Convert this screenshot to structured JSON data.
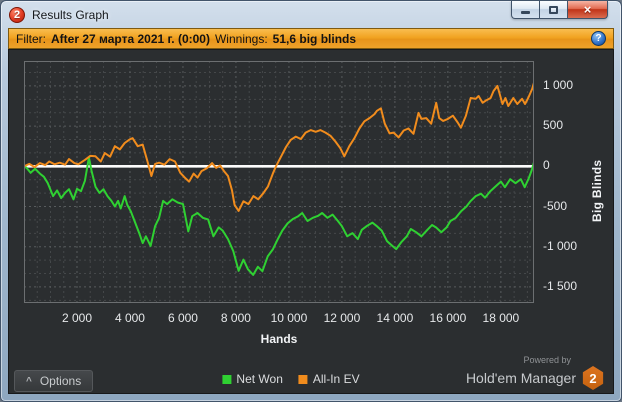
{
  "window": {
    "title": "Results Graph",
    "logo_glyph": "2",
    "controls": {
      "close_glyph": "×"
    }
  },
  "filter_bar": {
    "filter_label": "Filter:",
    "filter_value": "After 27 марта 2021 г. (0:00)",
    "winnings_label": "Winnings:",
    "winnings_value": "51,6 big blinds",
    "info_glyph": "?"
  },
  "chart_data": {
    "type": "line",
    "xlabel": "Hands",
    "ylabel": "Big Blinds",
    "xlim": [
      0,
      19250
    ],
    "ylim": [
      -1700,
      1310
    ],
    "grid": {
      "on": true,
      "x_minor": 500,
      "x_major": 2000,
      "y_major": 500,
      "y_minor_divisions": 3
    },
    "zero_line": true,
    "legend_position": "bottom",
    "background": "#2b2e30",
    "x_ticks": [
      {
        "value": 2000,
        "label": "2 000"
      },
      {
        "value": 4000,
        "label": "4 000"
      },
      {
        "value": 6000,
        "label": "6 000"
      },
      {
        "value": 8000,
        "label": "8 000"
      },
      {
        "value": 10000,
        "label": "10 000"
      },
      {
        "value": 12000,
        "label": "12 000"
      },
      {
        "value": 14000,
        "label": "14 000"
      },
      {
        "value": 16000,
        "label": "16 000"
      },
      {
        "value": 18000,
        "label": "18 000"
      }
    ],
    "y_ticks": [
      {
        "value": 1000,
        "label": "1 000"
      },
      {
        "value": 500,
        "label": "500"
      },
      {
        "value": 0,
        "label": "0"
      },
      {
        "value": -500,
        "label": "-500"
      },
      {
        "value": -1000,
        "label": "-1 000"
      },
      {
        "value": -1500,
        "label": "-1 500"
      }
    ],
    "series": [
      {
        "name": "Net Won",
        "color": "#2fd132",
        "points": [
          [
            0,
            0
          ],
          [
            100,
            -20
          ],
          [
            250,
            -80
          ],
          [
            420,
            -30
          ],
          [
            600,
            -90
          ],
          [
            750,
            -130
          ],
          [
            900,
            -210
          ],
          [
            1100,
            -370
          ],
          [
            1250,
            -300
          ],
          [
            1400,
            -395
          ],
          [
            1550,
            -330
          ],
          [
            1700,
            -285
          ],
          [
            1870,
            -410
          ],
          [
            2000,
            -280
          ],
          [
            2150,
            -310
          ],
          [
            2300,
            -180
          ],
          [
            2450,
            110
          ],
          [
            2550,
            -60
          ],
          [
            2700,
            -255
          ],
          [
            2850,
            -330
          ],
          [
            3000,
            -285
          ],
          [
            3150,
            -370
          ],
          [
            3300,
            -430
          ],
          [
            3430,
            -500
          ],
          [
            3550,
            -430
          ],
          [
            3650,
            -525
          ],
          [
            3800,
            -370
          ],
          [
            3900,
            -480
          ],
          [
            4030,
            -560
          ],
          [
            4200,
            -705
          ],
          [
            4350,
            -830
          ],
          [
            4480,
            -955
          ],
          [
            4600,
            -870
          ],
          [
            4780,
            -990
          ],
          [
            4950,
            -745
          ],
          [
            5100,
            -640
          ],
          [
            5250,
            -430
          ],
          [
            5400,
            -470
          ],
          [
            5600,
            -410
          ],
          [
            5800,
            -450
          ],
          [
            6000,
            -470
          ],
          [
            6200,
            -810
          ],
          [
            6350,
            -620
          ],
          [
            6550,
            -580
          ],
          [
            6750,
            -640
          ],
          [
            6950,
            -660
          ],
          [
            7150,
            -870
          ],
          [
            7350,
            -760
          ],
          [
            7500,
            -800
          ],
          [
            7700,
            -905
          ],
          [
            7900,
            -1055
          ],
          [
            8100,
            -1300
          ],
          [
            8280,
            -1160
          ],
          [
            8450,
            -1280
          ],
          [
            8650,
            -1350
          ],
          [
            8830,
            -1250
          ],
          [
            9000,
            -1305
          ],
          [
            9200,
            -1120
          ],
          [
            9400,
            -1030
          ],
          [
            9580,
            -905
          ],
          [
            9750,
            -800
          ],
          [
            9950,
            -710
          ],
          [
            10150,
            -655
          ],
          [
            10350,
            -620
          ],
          [
            10500,
            -580
          ],
          [
            10700,
            -680
          ],
          [
            10900,
            -640
          ],
          [
            11100,
            -615
          ],
          [
            11250,
            -580
          ],
          [
            11450,
            -640
          ],
          [
            11650,
            -600
          ],
          [
            11850,
            -680
          ],
          [
            12000,
            -745
          ],
          [
            12200,
            -870
          ],
          [
            12400,
            -830
          ],
          [
            12600,
            -905
          ],
          [
            12750,
            -790
          ],
          [
            12950,
            -740
          ],
          [
            13150,
            -700
          ],
          [
            13300,
            -740
          ],
          [
            13500,
            -800
          ],
          [
            13700,
            -930
          ],
          [
            13900,
            -990
          ],
          [
            14050,
            -1030
          ],
          [
            14250,
            -940
          ],
          [
            14450,
            -870
          ],
          [
            14600,
            -780
          ],
          [
            14800,
            -820
          ],
          [
            15000,
            -870
          ],
          [
            15200,
            -800
          ],
          [
            15400,
            -730
          ],
          [
            15550,
            -760
          ],
          [
            15750,
            -820
          ],
          [
            15950,
            -760
          ],
          [
            16100,
            -680
          ],
          [
            16300,
            -640
          ],
          [
            16500,
            -560
          ],
          [
            16700,
            -500
          ],
          [
            16850,
            -435
          ],
          [
            17050,
            -370
          ],
          [
            17250,
            -340
          ],
          [
            17400,
            -390
          ],
          [
            17600,
            -310
          ],
          [
            17800,
            -250
          ],
          [
            18000,
            -190
          ],
          [
            18150,
            -260
          ],
          [
            18350,
            -160
          ],
          [
            18550,
            -210
          ],
          [
            18750,
            -160
          ],
          [
            18900,
            -260
          ],
          [
            19050,
            -150
          ],
          [
            19150,
            -60
          ],
          [
            19250,
            52
          ]
        ]
      },
      {
        "name": "All-In EV",
        "color": "#f18c1d",
        "points": [
          [
            0,
            0
          ],
          [
            200,
            30
          ],
          [
            400,
            -10
          ],
          [
            600,
            40
          ],
          [
            800,
            15
          ],
          [
            950,
            60
          ],
          [
            1150,
            25
          ],
          [
            1350,
            45
          ],
          [
            1550,
            20
          ],
          [
            1700,
            90
          ],
          [
            1900,
            40
          ],
          [
            2050,
            25
          ],
          [
            2300,
            80
          ],
          [
            2500,
            130
          ],
          [
            2700,
            125
          ],
          [
            2900,
            60
          ],
          [
            3050,
            165
          ],
          [
            3250,
            120
          ],
          [
            3430,
            250
          ],
          [
            3620,
            210
          ],
          [
            3800,
            290
          ],
          [
            3990,
            335
          ],
          [
            4100,
            350
          ],
          [
            4290,
            250
          ],
          [
            4480,
            270
          ],
          [
            4660,
            60
          ],
          [
            4810,
            -120
          ],
          [
            4950,
            30
          ],
          [
            5100,
            45
          ],
          [
            5300,
            20
          ],
          [
            5500,
            90
          ],
          [
            5700,
            60
          ],
          [
            5900,
            -80
          ],
          [
            6100,
            -150
          ],
          [
            6230,
            -190
          ],
          [
            6400,
            -90
          ],
          [
            6550,
            -140
          ],
          [
            6700,
            -60
          ],
          [
            6900,
            -25
          ],
          [
            7100,
            40
          ],
          [
            7250,
            -20
          ],
          [
            7400,
            10
          ],
          [
            7550,
            -60
          ],
          [
            7700,
            -120
          ],
          [
            7850,
            -300
          ],
          [
            7950,
            -480
          ],
          [
            8100,
            -555
          ],
          [
            8280,
            -435
          ],
          [
            8470,
            -470
          ],
          [
            8660,
            -370
          ],
          [
            8840,
            -410
          ],
          [
            9030,
            -335
          ],
          [
            9210,
            -250
          ],
          [
            9400,
            -85
          ],
          [
            9510,
            0
          ],
          [
            9700,
            120
          ],
          [
            9890,
            240
          ],
          [
            10070,
            330
          ],
          [
            10260,
            370
          ],
          [
            10450,
            340
          ],
          [
            10630,
            420
          ],
          [
            10820,
            450
          ],
          [
            11010,
            430
          ],
          [
            11190,
            450
          ],
          [
            11380,
            420
          ],
          [
            11570,
            380
          ],
          [
            11750,
            310
          ],
          [
            11940,
            225
          ],
          [
            12090,
            125
          ],
          [
            12280,
            250
          ],
          [
            12470,
            350
          ],
          [
            12660,
            470
          ],
          [
            12850,
            560
          ],
          [
            13040,
            600
          ],
          [
            13230,
            650
          ],
          [
            13320,
            690
          ],
          [
            13470,
            720
          ],
          [
            13620,
            530
          ],
          [
            13800,
            410
          ],
          [
            13950,
            420
          ],
          [
            14140,
            360
          ],
          [
            14330,
            445
          ],
          [
            14510,
            470
          ],
          [
            14700,
            405
          ],
          [
            14890,
            665
          ],
          [
            15000,
            590
          ],
          [
            15180,
            600
          ],
          [
            15370,
            530
          ],
          [
            15560,
            790
          ],
          [
            15670,
            600
          ],
          [
            15820,
            565
          ],
          [
            16000,
            590
          ],
          [
            16190,
            630
          ],
          [
            16370,
            545
          ],
          [
            16490,
            480
          ],
          [
            16680,
            630
          ],
          [
            16860,
            850
          ],
          [
            17050,
            840
          ],
          [
            17160,
            875
          ],
          [
            17310,
            790
          ],
          [
            17420,
            815
          ],
          [
            17610,
            850
          ],
          [
            17720,
            935
          ],
          [
            17870,
            1000
          ],
          [
            18060,
            775
          ],
          [
            18170,
            850
          ],
          [
            18280,
            750
          ],
          [
            18470,
            850
          ],
          [
            18620,
            775
          ],
          [
            18800,
            840
          ],
          [
            18910,
            775
          ],
          [
            19030,
            850
          ],
          [
            19180,
            960
          ],
          [
            19250,
            1040
          ]
        ]
      }
    ]
  },
  "bottom_bar": {
    "options_label": "Options",
    "chevron_glyph": "^",
    "legend": [
      {
        "label": "Net Won",
        "color": "#2fd132"
      },
      {
        "label": "All-In EV",
        "color": "#f18c1d"
      }
    ],
    "powered_by": "Powered by",
    "brand": "Hold'em Manager",
    "brand_badge": "2",
    "brand_badge_color": "#dd7420"
  }
}
